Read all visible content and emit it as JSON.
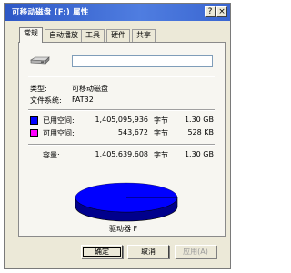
{
  "window": {
    "title": "可移动磁盘 (F:) 属性",
    "help_label": "?",
    "close_label": "×"
  },
  "tabs": [
    {
      "label": "常规",
      "active": true
    },
    {
      "label": "自动播放",
      "active": false
    },
    {
      "label": "工具",
      "active": false
    },
    {
      "label": "硬件",
      "active": false
    },
    {
      "label": "共享",
      "active": false
    }
  ],
  "general": {
    "volume_name_value": "",
    "type_label": "类型:",
    "type_value": "可移动磁盘",
    "filesystem_label": "文件系统:",
    "filesystem_value": "FAT32",
    "used": {
      "label": "已用空间:",
      "bytes": "1,405,095,936",
      "bytes_unit": "字节",
      "size": "1.30 GB",
      "color": "#0000ff"
    },
    "free": {
      "label": "可用空间:",
      "bytes": "543,672",
      "bytes_unit": "字节",
      "size": "528 KB",
      "color": "#ff00ff"
    },
    "capacity": {
      "label": "容量:",
      "bytes": "1,405,639,608",
      "bytes_unit": "字节",
      "size": "1.30 GB"
    },
    "drive_label": "驱动器 F"
  },
  "chart_data": {
    "type": "pie",
    "categories": [
      "已用空间",
      "可用空间"
    ],
    "values": [
      1405095936,
      543672
    ],
    "colors": [
      "#0000ff",
      "#ff00ff"
    ]
  },
  "buttons": {
    "ok": "确定",
    "cancel": "取消",
    "apply": "应用(A)"
  }
}
